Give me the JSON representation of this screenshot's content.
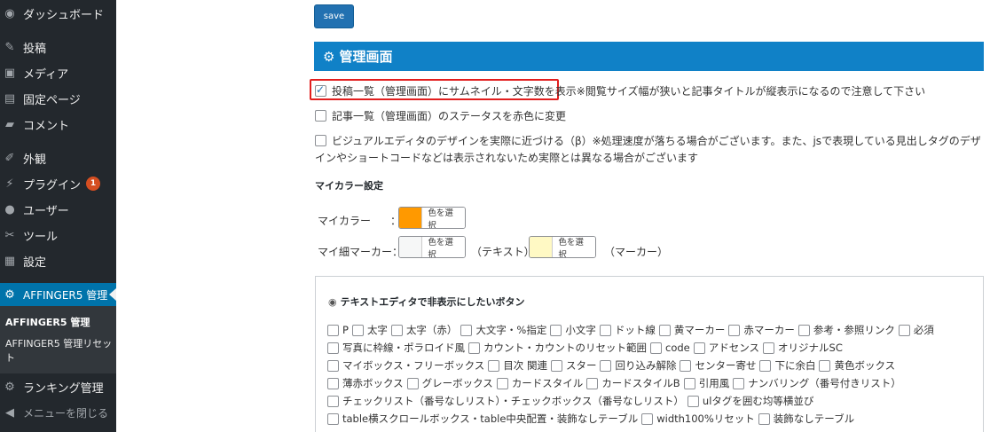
{
  "sidebar": {
    "items": [
      {
        "label": "ダッシュボード",
        "icon": "dashboard-icon",
        "glyph": "◉"
      },
      {
        "label": "投稿",
        "icon": "pin-icon",
        "glyph": "✎"
      },
      {
        "label": "メディア",
        "icon": "media-icon",
        "glyph": "▣"
      },
      {
        "label": "固定ページ",
        "icon": "page-icon",
        "glyph": "▤"
      },
      {
        "label": "コメント",
        "icon": "comment-icon",
        "glyph": "▰"
      },
      {
        "label": "外観",
        "icon": "appearance-icon",
        "glyph": "✐"
      },
      {
        "label": "プラグイン",
        "icon": "plugin-icon",
        "glyph": "⚡",
        "badge": "1"
      },
      {
        "label": "ユーザー",
        "icon": "user-icon",
        "glyph": "●"
      },
      {
        "label": "ツール",
        "icon": "tool-icon",
        "glyph": "✂"
      },
      {
        "label": "設定",
        "icon": "settings-icon",
        "glyph": "▦"
      },
      {
        "label": "AFFINGER5 管理",
        "icon": "gear-icon",
        "glyph": "⚙"
      },
      {
        "label": "ランキング管理",
        "icon": "gear-icon",
        "glyph": "⚙"
      },
      {
        "label": "メニューを閉じる",
        "icon": "collapse-icon",
        "glyph": "◀"
      }
    ],
    "submenu": [
      "AFFINGER5 管理",
      "AFFINGER5 管理リセット"
    ]
  },
  "main": {
    "save_label": "save",
    "section_title": "管理画面",
    "options": [
      {
        "label": "投稿一覧（管理画面）にサムネイル・文字数を表示",
        "note": "※閲覧サイズ幅が狭いと記事タイトルが縦表示になるので注意して下さい",
        "checked": true
      },
      {
        "label": "記事一覧（管理画面）のステータスを赤色に変更",
        "checked": false
      },
      {
        "label": "ビジュアルエディタのデザインを実際に近づける（β）※処理速度が落ちる場合がございます。また、jsで表現している見出しタグのデザインやショートコードなどは表示されないため実際とは異なる場合がございます",
        "checked": false
      }
    ],
    "mycolor": {
      "heading": "マイカラー設定",
      "rows": [
        {
          "label": "マイカラー",
          "colon": "：",
          "pick_label": "色を選択",
          "color": "#ff9900"
        },
        {
          "label": "マイ細マーカー",
          "colon": "：",
          "pick_label": "色を選択",
          "color": "#f6f7f7",
          "after": "（テキスト）",
          "pick_label2": "色を選択",
          "color2": "#fff9c4",
          "after2": "（マーカー）"
        }
      ]
    },
    "editor": {
      "heading": "テキストエディタで非表示にしたいボタン",
      "rows": [
        [
          "P",
          "太字",
          "太字（赤）",
          "大文字・%指定",
          "小文字",
          "ドット線",
          "黄マーカー",
          "赤マーカー",
          "参考・参照リンク",
          "必須"
        ],
        [
          "写真に枠線・ポラロイド風",
          "カウント・カウントのリセット範囲",
          "code",
          "アドセンス",
          "オリジナルSC"
        ],
        [
          "マイボックス・フリーボックス",
          "目次 関連",
          "スター",
          "回り込み解除",
          "センター寄せ",
          "下に余白",
          "黄色ボックス"
        ],
        [
          "薄赤ボックス",
          "グレーボックス",
          "カードスタイル",
          "カードスタイルB",
          "引用風",
          "ナンバリング（番号付きリスト）"
        ],
        [
          "チェックリスト（番号なしリスト）・チェックボックス（番号なしリスト）",
          "ulタグを囲む均等横並び"
        ],
        [
          "table横スクロールボックス・table中央配置・装飾なしテーブル",
          "width100%リセット",
          "装飾なしテーブル"
        ]
      ]
    }
  }
}
